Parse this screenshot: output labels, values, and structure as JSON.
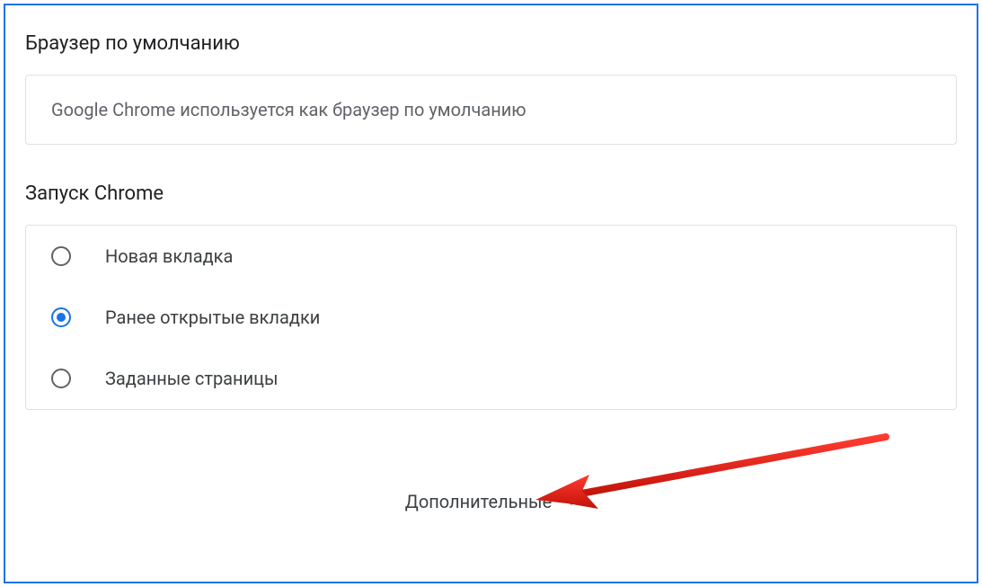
{
  "default_browser": {
    "title": "Браузер по умолчанию",
    "status": "Google Chrome используется как браузер по умолчанию"
  },
  "on_startup": {
    "title": "Запуск Chrome",
    "options": [
      {
        "label": "Новая вкладка",
        "selected": false
      },
      {
        "label": "Ранее открытые вкладки",
        "selected": true
      },
      {
        "label": "Заданные страницы",
        "selected": false
      }
    ]
  },
  "advanced": {
    "label": "Дополнительные"
  }
}
